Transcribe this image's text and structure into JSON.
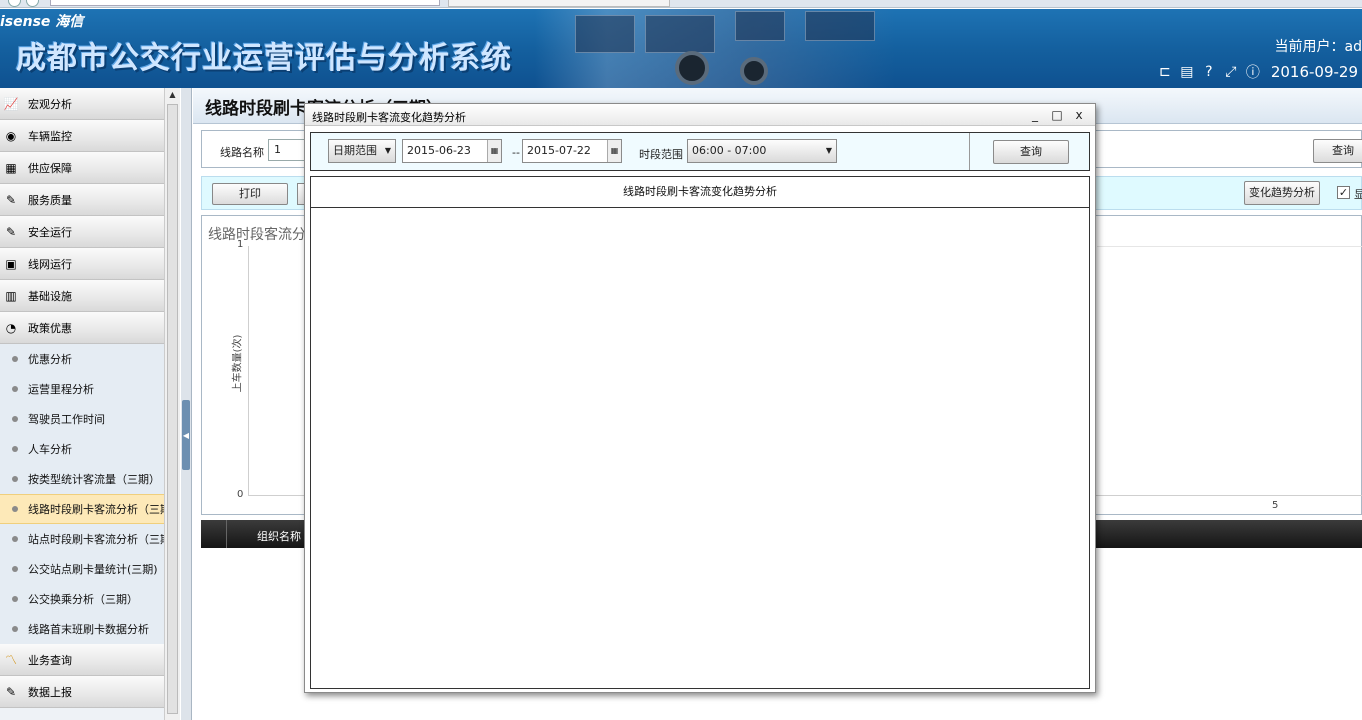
{
  "header": {
    "brand": "isense 海信",
    "system_title": "成都市公交行业运营评估与分析系统",
    "current_user": "当前用户：ad",
    "date": "2016-09-29"
  },
  "sidebar": {
    "groups_top": [
      {
        "label": "宏观分析",
        "icon": "trend-chart-icon"
      },
      {
        "label": "车辆监控",
        "icon": "camera-icon"
      },
      {
        "label": "供应保障",
        "icon": "truck-icon"
      },
      {
        "label": "服务质量",
        "icon": "edit-chart-icon"
      },
      {
        "label": "安全运行",
        "icon": "shield-edit-icon"
      },
      {
        "label": "线网运行",
        "icon": "network-calendar-icon"
      },
      {
        "label": "基础设施",
        "icon": "building-icon"
      },
      {
        "label": "政策优惠",
        "icon": "document-icon"
      }
    ],
    "sub_items": [
      {
        "label": "优惠分析",
        "active": false
      },
      {
        "label": "运营里程分析",
        "active": false
      },
      {
        "label": "驾驶员工作时间",
        "active": false
      },
      {
        "label": "人车分析",
        "active": false
      },
      {
        "label": "按类型统计客流量（三期）",
        "active": false
      },
      {
        "label": "线路时段刷卡客流分析（三期）",
        "active": true
      },
      {
        "label": "站点时段刷卡客流分析（三期）",
        "active": false
      },
      {
        "label": "公交站点刷卡量统计(三期)",
        "active": false
      },
      {
        "label": "公交换乘分析（三期）",
        "active": false
      },
      {
        "label": "线路首末班刷卡数据分析",
        "active": false
      }
    ],
    "groups_bottom": [
      {
        "label": "业务查询",
        "icon": "line-chart-icon"
      },
      {
        "label": "数据上报",
        "icon": "report-icon"
      }
    ]
  },
  "main": {
    "page_title": "线路时段刷卡客流分析（三期）",
    "filter": {
      "line_label": "线路名称",
      "line_value": "1",
      "query_label": "查询"
    },
    "toolbar": {
      "print_label": "打印",
      "trend_label": "变化趋势分析",
      "check_mark": "✓",
      "check_label": "显"
    },
    "chart": {
      "title": "线路时段客流分",
      "ylabel": "上车数量(次)",
      "y_top_tick": "1",
      "y_bottom_tick": "0",
      "x_tick": "5"
    },
    "grid": {
      "col_org": "组织名称"
    }
  },
  "dialog": {
    "title": "线路时段刷卡客流变化趋势分析",
    "range_type": "日期范围",
    "date_from": "2015-06-23",
    "date_sep": "--",
    "date_to": "2015-07-22",
    "period_label": "时段范围",
    "period_value": "06:00 - 07:00",
    "query_label": "查询",
    "chart_title": "线路时段刷卡客流变化趋势分析"
  },
  "chart_data": {
    "type": "line",
    "title": "",
    "xlabel": "",
    "ylabel": "上车数量(次)",
    "ylim": [
      0,
      1
    ],
    "series": []
  }
}
